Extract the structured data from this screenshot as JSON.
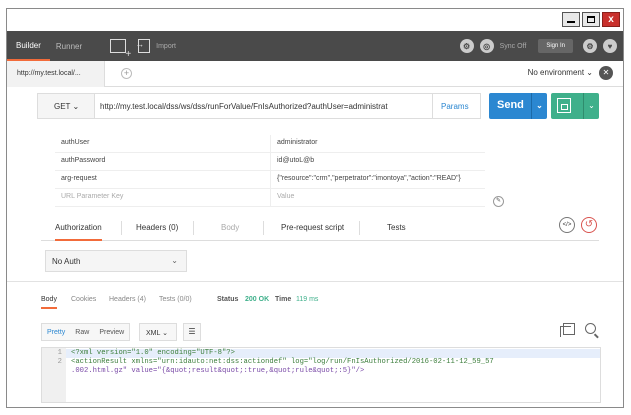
{
  "window": {
    "minimize_glyph": "",
    "maximize_glyph": "",
    "close_glyph": "x"
  },
  "header": {
    "tab_builder": "Builder",
    "tab_runner": "Runner",
    "import_label": "Import",
    "sync_label": "Sync Off",
    "sign_in_label": "Sign In",
    "accent_color": "#f26b3a"
  },
  "tabs": {
    "request_tab_label": "http://my.test.local/...",
    "add_tab_glyph": "+",
    "environment_label": "No environment ⌄"
  },
  "request": {
    "method": "GET ⌄",
    "url": "http://my.test.local/dss/ws/dss/runForValue/FnIsAuthorized?authUser=administrat",
    "params_label": "Params",
    "send_label": "Send",
    "send_caret": "⌄",
    "save_caret": "⌄",
    "send_color": "#2b87d1",
    "save_color": "#3fb08b"
  },
  "params": {
    "rows": [
      {
        "key": "authUser",
        "value": "administrator"
      },
      {
        "key": "authPassword",
        "value": "id@utoL@b"
      },
      {
        "key": "arg-request",
        "value": "{\"resource\":\"crm\",\"perpetrator\":\"imontoya\",\"action\":\"READ\"}"
      }
    ],
    "key_placeholder": "URL Parameter Key",
    "value_placeholder": "Value"
  },
  "builder_tabs": {
    "authorization": "Authorization",
    "headers": "Headers (0)",
    "body": "Body",
    "prerequest": "Pre-request script",
    "tests": "Tests",
    "code_glyph": "</>",
    "reset_glyph": "↺"
  },
  "auth": {
    "type": "No Auth",
    "caret": "⌄"
  },
  "response": {
    "tab_body": "Body",
    "tab_cookies": "Cookies",
    "tab_headers": "Headers (4)",
    "tab_tests": "Tests (0/0)",
    "status_label": "Status",
    "status_value": "200 OK",
    "time_label": "Time",
    "time_value": "119 ms",
    "format_pretty": "Pretty",
    "format_raw": "Raw",
    "format_preview": "Preview",
    "language": "XML ⌄",
    "wrap_glyph": "☰",
    "lines": [
      {
        "number": "1",
        "text": "<?xml version=\"1.0\" encoding=\"UTF-8\"?>"
      },
      {
        "number": "2",
        "text": "<actionResult xmlns=\"urn:idauto:net:dss:actiondef\" log=\"log/run/FnIsAuthorized/2016-02-11-12_59_57"
      },
      {
        "number": "",
        "text": ".002.html.gz\" value=\"{&quot;result&quot;:true,&quot;rule&quot;:5}\"/>"
      }
    ]
  }
}
